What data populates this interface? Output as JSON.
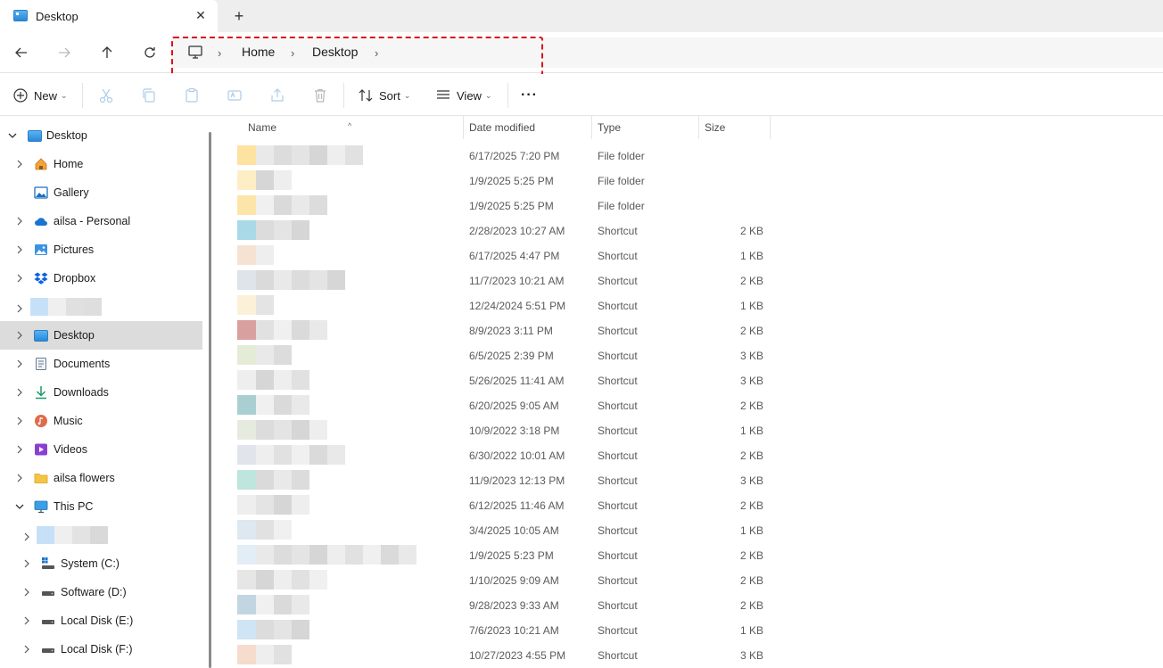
{
  "window": {
    "tab_title": "Desktop",
    "tab_close": "✕",
    "new_tab": "+"
  },
  "breadcrumb": {
    "items": [
      "Home",
      "Desktop"
    ],
    "separator": "›"
  },
  "toolbar": {
    "new_label": "New",
    "sort_label": "Sort",
    "view_label": "View",
    "more_label": "···"
  },
  "sidebar": {
    "items": [
      {
        "label": "Desktop"
      },
      {
        "label": "Home"
      },
      {
        "label": "Gallery"
      },
      {
        "label": "ailsa - Personal"
      },
      {
        "label": "Pictures"
      },
      {
        "label": "Dropbox"
      },
      {
        "label": ""
      },
      {
        "label": "Desktop"
      },
      {
        "label": "Documents"
      },
      {
        "label": "Downloads"
      },
      {
        "label": "Music"
      },
      {
        "label": "Videos"
      },
      {
        "label": "ailsa flowers"
      },
      {
        "label": "This PC"
      },
      {
        "label": ""
      },
      {
        "label": "System (C:)"
      },
      {
        "label": "Software (D:)"
      },
      {
        "label": "Local Disk (E:)"
      },
      {
        "label": "Local Disk (F:)"
      }
    ]
  },
  "file_list": {
    "columns": [
      "Name",
      "Date modified",
      "Type",
      "Size"
    ],
    "rows": [
      {
        "date": "6/17/2025 7:20 PM",
        "type": "File folder",
        "size": "",
        "icon_color": "#fde2a0"
      },
      {
        "date": "1/9/2025 5:25 PM",
        "type": "File folder",
        "size": "",
        "icon_color": "#fdeec6"
      },
      {
        "date": "1/9/2025 5:25 PM",
        "type": "File folder",
        "size": "",
        "icon_color": "#fde4a8"
      },
      {
        "date": "2/28/2023 10:27 AM",
        "type": "Shortcut",
        "size": "2 KB",
        "icon_color": "#a9d9e6"
      },
      {
        "date": "6/17/2025 4:47 PM",
        "type": "Shortcut",
        "size": "1 KB",
        "icon_color": "#f6e2d2"
      },
      {
        "date": "11/7/2023 10:21 AM",
        "type": "Shortcut",
        "size": "2 KB",
        "icon_color": "#dfe3ea"
      },
      {
        "date": "12/24/2024 5:51 PM",
        "type": "Shortcut",
        "size": "1 KB",
        "icon_color": "#fcf1d8"
      },
      {
        "date": "8/9/2023 3:11 PM",
        "type": "Shortcut",
        "size": "2 KB",
        "icon_color": "#d9a0a0"
      },
      {
        "date": "6/5/2025 2:39 PM",
        "type": "Shortcut",
        "size": "3 KB",
        "icon_color": "#e4ecd8"
      },
      {
        "date": "5/26/2025 11:41 AM",
        "type": "Shortcut",
        "size": "3 KB",
        "icon_color": "#eeeeee"
      },
      {
        "date": "6/20/2025 9:05 AM",
        "type": "Shortcut",
        "size": "2 KB",
        "icon_color": "#a9cfd2"
      },
      {
        "date": "10/9/2022 3:18 PM",
        "type": "Shortcut",
        "size": "1 KB",
        "icon_color": "#e6ebdf"
      },
      {
        "date": "6/30/2022 10:01 AM",
        "type": "Shortcut",
        "size": "2 KB",
        "icon_color": "#e1e5eb"
      },
      {
        "date": "11/9/2023 12:13 PM",
        "type": "Shortcut",
        "size": "3 KB",
        "icon_color": "#bfe6de"
      },
      {
        "date": "6/12/2025 11:46 AM",
        "type": "Shortcut",
        "size": "2 KB",
        "icon_color": "#eeeeee"
      },
      {
        "date": "3/4/2025 10:05 AM",
        "type": "Shortcut",
        "size": "1 KB",
        "icon_color": "#dde8f0"
      },
      {
        "date": "1/9/2025 5:23 PM",
        "type": "Shortcut",
        "size": "2 KB",
        "icon_color": "#e2edf6"
      },
      {
        "date": "1/10/2025 9:09 AM",
        "type": "Shortcut",
        "size": "2 KB",
        "icon_color": "#e6e6e6"
      },
      {
        "date": "9/28/2023 9:33 AM",
        "type": "Shortcut",
        "size": "2 KB",
        "icon_color": "#c2d6e2"
      },
      {
        "date": "7/6/2023 10:21 AM",
        "type": "Shortcut",
        "size": "1 KB",
        "icon_color": "#cfe4f4"
      },
      {
        "date": "10/27/2023 4:55 PM",
        "type": "Shortcut",
        "size": "3 KB",
        "icon_color": "#f5dccc"
      }
    ]
  }
}
